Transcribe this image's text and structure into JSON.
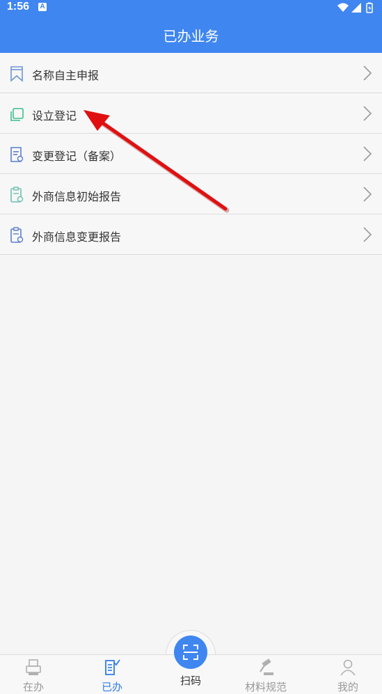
{
  "status_bar": {
    "time": "1:56",
    "notification_letter": "A"
  },
  "header": {
    "title": "已办业务"
  },
  "list": {
    "items": [
      {
        "label": "名称自主申报",
        "icon": "bookmark-icon"
      },
      {
        "label": "设立登记",
        "icon": "copy-square-icon"
      },
      {
        "label": "变更登记（备案）",
        "icon": "document-edit-icon"
      },
      {
        "label": "外商信息初始报告",
        "icon": "clipboard-plus-icon"
      },
      {
        "label": "外商信息变更报告",
        "icon": "clipboard-refresh-icon"
      }
    ]
  },
  "tabbar": {
    "tabs": [
      {
        "label": "在办",
        "icon": "printer-icon",
        "active": false
      },
      {
        "label": "已办",
        "icon": "document-check-icon",
        "active": true
      },
      {
        "label": "扫码",
        "icon": "scan-icon",
        "active": false
      },
      {
        "label": "材料规范",
        "icon": "gavel-icon",
        "active": false
      },
      {
        "label": "我的",
        "icon": "person-icon",
        "active": false
      }
    ]
  },
  "colors": {
    "brand": "#3f86f0",
    "active_tab": "#2f7be8",
    "annotation_arrow": "#e01010"
  }
}
